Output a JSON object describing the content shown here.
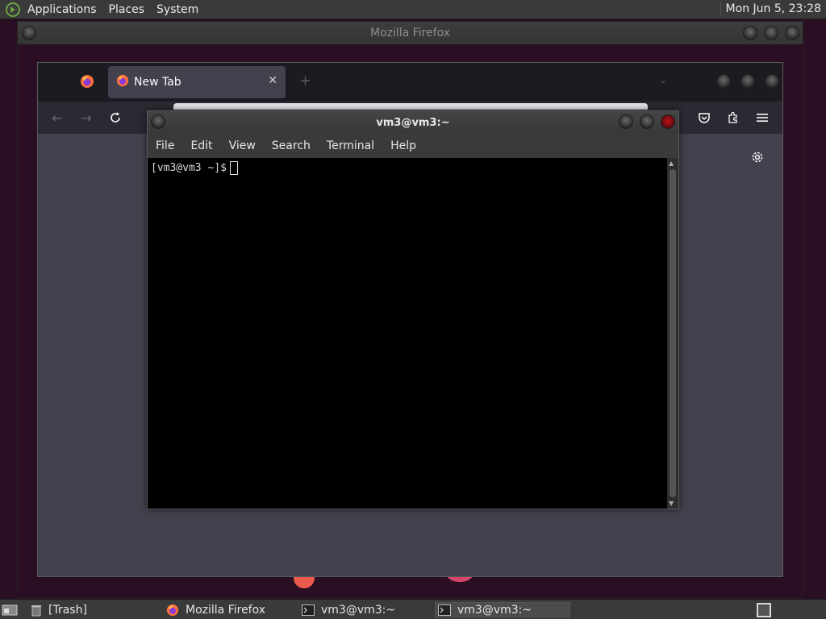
{
  "top_panel": {
    "menus": [
      "Applications",
      "Places",
      "System"
    ],
    "clock": "Mon Jun  5, 23:28"
  },
  "firefox_outer": {
    "title": "Mozilla Firefox"
  },
  "firefox": {
    "tab_label": "New Tab",
    "tab_close": "✕",
    "new_tab": "+",
    "list_tabs": "⌄"
  },
  "terminal": {
    "title": "vm3@vm3:~",
    "menus": [
      "File",
      "Edit",
      "View",
      "Search",
      "Terminal",
      "Help"
    ],
    "prompt": "[vm3@vm3 ~]$"
  },
  "taskbar": {
    "items": [
      "[Trash]",
      "Mozilla Firefox",
      "vm3@vm3:~",
      "vm3@vm3:~"
    ]
  },
  "colors": {
    "desktop": "#2a0f24",
    "panel": "#3a3a3a",
    "firefox_toolbar": "#2b2a33",
    "firefox_content": "#42414d",
    "terminal_bg": "#000000"
  }
}
